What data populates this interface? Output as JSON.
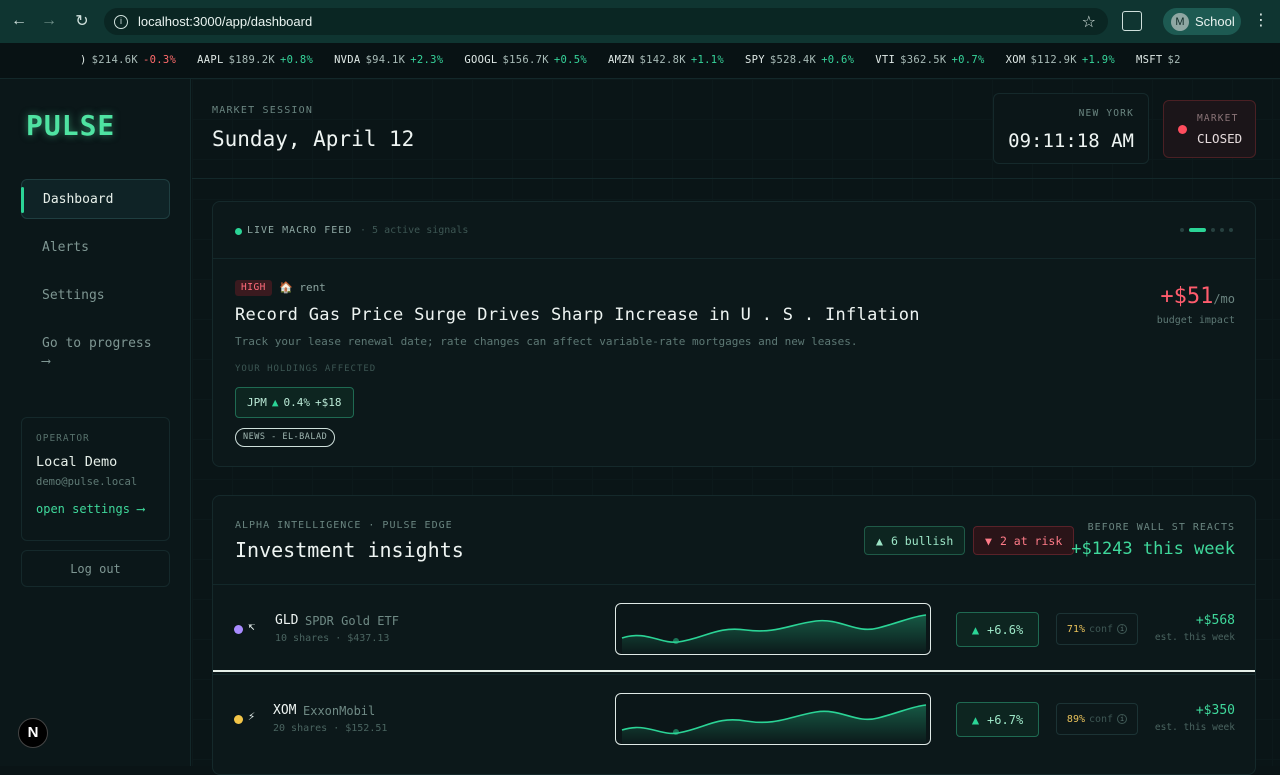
{
  "browser": {
    "url": "localhost:3000/app/dashboard",
    "profile_initial": "M",
    "profile_name": "School"
  },
  "ticker": [
    {
      "sym": "",
      "px": "$214.6K",
      "chg": "-0.3%",
      "dir": "dn",
      "partial": ")"
    },
    {
      "sym": "AAPL",
      "px": "$189.2K",
      "chg": "+0.8%",
      "dir": "up"
    },
    {
      "sym": "NVDA",
      "px": "$94.1K",
      "chg": "+2.3%",
      "dir": "up"
    },
    {
      "sym": "GOOGL",
      "px": "$156.7K",
      "chg": "+0.5%",
      "dir": "up"
    },
    {
      "sym": "AMZN",
      "px": "$142.8K",
      "chg": "+1.1%",
      "dir": "up"
    },
    {
      "sym": "SPY",
      "px": "$528.4K",
      "chg": "+0.6%",
      "dir": "up"
    },
    {
      "sym": "VTI",
      "px": "$362.5K",
      "chg": "+0.7%",
      "dir": "up"
    },
    {
      "sym": "XOM",
      "px": "$112.9K",
      "chg": "+1.9%",
      "dir": "up"
    },
    {
      "sym": "MSFT",
      "px": "$2",
      "chg": "",
      "dir": "up"
    }
  ],
  "sidebar": {
    "logo": "PULSE",
    "items": [
      {
        "label": "Dashboard"
      },
      {
        "label": "Alerts"
      },
      {
        "label": "Settings"
      },
      {
        "label": "Go to progress",
        "arrow": "⟶"
      }
    ],
    "operator": {
      "label": "OPERATOR",
      "name": "Local Demo",
      "email": "demo@pulse.local",
      "link": "open settings ⟶"
    },
    "logout": "Log out",
    "badge": "N"
  },
  "header": {
    "session_label": "MARKET SESSION",
    "date": "Sunday, April 12",
    "city": "NEW YORK",
    "time": "09:11:18 AM",
    "market_label": "MARKET",
    "market_status": "CLOSED"
  },
  "macro": {
    "feed_label": "LIVE MACRO FEED",
    "signals": "· 5 active signals",
    "severity": "HIGH",
    "category": "🏠 rent",
    "headline": "Record Gas Price Surge Drives Sharp Increase in U . S . Inflation",
    "subtext": "Track your lease renewal date; rate changes can affect variable-rate mortgages and new leases.",
    "holdings_label": "YOUR HOLDINGS AFFECTED",
    "holding": {
      "sym": "JPM",
      "tri": "▲",
      "chg": "0.4%",
      "amt": "+$18"
    },
    "source": "NEWS - EL-BALAD",
    "impact_value": "+$51",
    "impact_unit": "/mo",
    "impact_label": "budget impact"
  },
  "insights": {
    "top_label": "ALPHA INTELLIGENCE · PULSE EDGE",
    "title": "Investment insights",
    "bullish": "6 bullish",
    "at_risk": "2 at risk",
    "bwsr_label": "BEFORE WALL ST REACTS",
    "bwsr_value": "+$1243 this week",
    "rows": [
      {
        "dot": "#a98bff",
        "icon": "↸",
        "sym": "GLD",
        "name": "SPDR Gold ETF",
        "meta": "10 shares · $437.13",
        "chg": "+6.6%",
        "conf": "71%",
        "conf_lbl": "conf",
        "earn": "+$568",
        "earn_lbl": "est. this week"
      },
      {
        "dot": "#f3c548",
        "icon": "⚡",
        "sym": "XOM",
        "name": "ExxonMobil",
        "meta": "20 shares · $152.51",
        "chg": "+6.7%",
        "conf": "89%",
        "conf_lbl": "conf",
        "earn": "+$350",
        "earn_lbl": "est. this week"
      }
    ]
  },
  "colors": {
    "accent": "#2bd496",
    "danger": "#ff5c6d",
    "bg": "#0a1416"
  }
}
